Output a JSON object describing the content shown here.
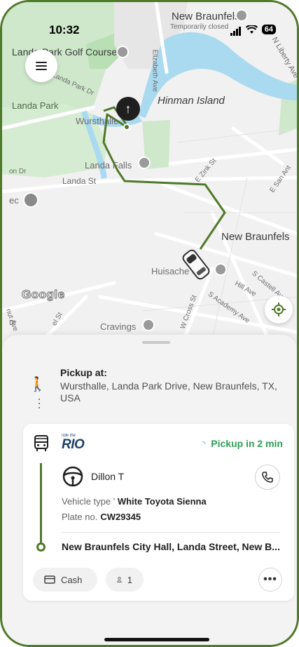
{
  "status_bar": {
    "time": "10:32",
    "battery": "64"
  },
  "map": {
    "labels": {
      "new_braunfels_top": "New Braunfels",
      "temporarily_closed": "Temporarily closed",
      "landa_park_golf": "Landa Park Golf Course",
      "landa_park_dr": "Landa Park Dr",
      "elizabeth_ave": "Elizabeth Ave",
      "hinman_island": "Hinman Island",
      "landa_park": "Landa Park",
      "wursthalle": "Wursthalle",
      "landa_falls": "Landa Falls",
      "e_zink_st": "E Zink St",
      "landa_st": "Landa St",
      "on_dr": "on Dr",
      "ec": "ec",
      "e_san_antonio": "E San Ant",
      "new_braunfels_mid": "New Braunfels",
      "huisache_grill": "Huisache Grill",
      "s_castell_ave": "S Castell Ave",
      "hill_ave": "Hill Ave",
      "s_academy_ave": "S Academy Ave",
      "w_cross_st": "W Cross St",
      "cravings": "Cravings",
      "nut_ave": "nut Ave",
      "el_st": "el St",
      "dr": "Dr",
      "n_liberty_ave": "N Liberty Ave",
      "google": "Google"
    }
  },
  "sheet": {
    "pickup_title": "Pickup at:",
    "pickup_address": "Wursthalle, Landa Park Drive, New Braunfels, TX, USA",
    "ride": {
      "brand_tag": "ride the",
      "brand_name": "RIO",
      "eta": "Pickup in 2 min",
      "driver_name": "Dillon T",
      "vehicle_label": "Vehicle type",
      "vehicle_value": "White Toyota Sienna",
      "plate_label": "Plate no.",
      "plate_value": "CW29345",
      "destination": "New Braunfels City Hall, Landa Street, New B...",
      "payment": "Cash",
      "passengers": "1"
    }
  },
  "colors": {
    "accent_green": "#4f7a28",
    "eta_green": "#2f9e55",
    "brand_blue": "#1d3f66"
  },
  "icons": [
    "menu-icon",
    "navigation-arrow-icon",
    "locate-icon",
    "walk-icon",
    "bus-icon",
    "steering-wheel-icon",
    "phone-icon",
    "card-icon",
    "person-icon",
    "more-icon"
  ]
}
